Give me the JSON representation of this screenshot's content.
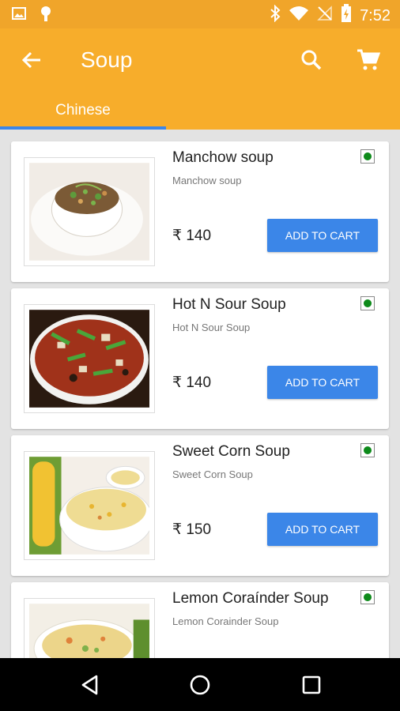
{
  "status_bar": {
    "time": "7:52",
    "icons": [
      "image-icon",
      "android-icon",
      "bluetooth-icon",
      "wifi-icon",
      "no-signal-icon",
      "battery-charging-icon"
    ]
  },
  "app_bar": {
    "title": "Soup",
    "back_icon": "arrow-back-icon",
    "search_icon": "search-icon",
    "cart_icon": "shopping-cart-icon",
    "tabs": [
      {
        "label": "Chinese",
        "selected": true
      }
    ]
  },
  "colors": {
    "status_bar": "#f0a52a",
    "app_bar": "#f7ad2b",
    "accent": "#3b86e8",
    "veg_indicator": "#0d8a1a"
  },
  "items": [
    {
      "name": "Manchow soup",
      "description": "Manchow soup",
      "price": "₹ 140",
      "button_label": "ADD TO CART",
      "veg": true
    },
    {
      "name": "Hot N Sour Soup",
      "description": "Hot N Sour Soup",
      "price": "₹ 140",
      "button_label": "ADD TO CART",
      "veg": true
    },
    {
      "name": "Sweet Corn Soup",
      "description": "Sweet Corn Soup",
      "price": "₹ 150",
      "button_label": "ADD TO CART",
      "veg": true
    },
    {
      "name": "Lemon Coraínder Soup",
      "description": "Lemon Corainder Soup",
      "veg": true
    }
  ],
  "nav_bar": {
    "icons": [
      "back-triangle-icon",
      "home-circle-icon",
      "recents-square-icon"
    ]
  }
}
